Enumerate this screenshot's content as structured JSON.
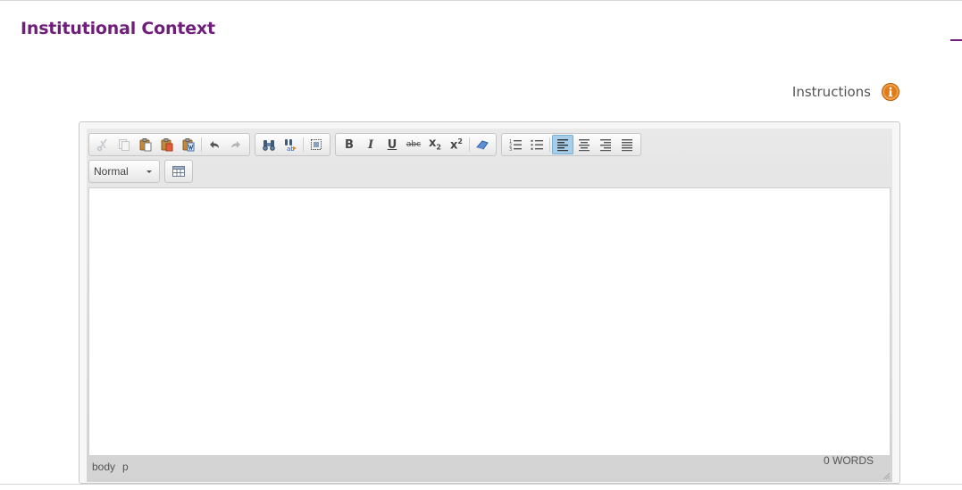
{
  "section": {
    "title": "Institutional Context"
  },
  "instructions": {
    "label": "Instructions",
    "icon": "info-icon",
    "icon_color": "#e07b16"
  },
  "colors": {
    "title": "#6f1f7a",
    "active_button": "#a6cde9"
  },
  "editor": {
    "toolbar_row1": [
      {
        "group": "clipboard",
        "buttons": [
          {
            "name": "cut",
            "icon": "scissors-icon",
            "enabled": false
          },
          {
            "name": "copy",
            "icon": "copy-icon",
            "enabled": false
          },
          {
            "name": "paste",
            "icon": "paste-icon",
            "enabled": true
          },
          {
            "name": "paste-as-text",
            "icon": "paste-text-icon",
            "enabled": true
          },
          {
            "name": "paste-from-word",
            "icon": "paste-word-icon",
            "enabled": true
          },
          {
            "name": "undo",
            "icon": "undo-icon",
            "enabled": true
          },
          {
            "name": "redo",
            "icon": "redo-icon",
            "enabled": false
          }
        ]
      },
      {
        "group": "editing",
        "buttons": [
          {
            "name": "find",
            "icon": "binoculars-icon",
            "enabled": true
          },
          {
            "name": "replace",
            "icon": "replace-icon",
            "enabled": true
          },
          {
            "name": "select-all",
            "icon": "select-all-icon",
            "enabled": true
          }
        ]
      },
      {
        "group": "basicstyles",
        "buttons": [
          {
            "name": "bold",
            "label": "B"
          },
          {
            "name": "italic",
            "label": "I"
          },
          {
            "name": "underline",
            "label": "U"
          },
          {
            "name": "strikethrough",
            "label": "abc"
          },
          {
            "name": "subscript",
            "label": "x",
            "script": "2"
          },
          {
            "name": "superscript",
            "label": "x",
            "script": "2"
          },
          {
            "name": "remove-format",
            "icon": "eraser-icon"
          }
        ]
      },
      {
        "group": "paragraph",
        "buttons": [
          {
            "name": "numbered-list",
            "icon": "numbered-list-icon"
          },
          {
            "name": "bulleted-list",
            "icon": "bulleted-list-icon"
          },
          {
            "name": "align-left",
            "icon": "align-left-icon",
            "active": true
          },
          {
            "name": "align-center",
            "icon": "align-center-icon"
          },
          {
            "name": "align-right",
            "icon": "align-right-icon"
          },
          {
            "name": "justify",
            "icon": "justify-icon"
          }
        ]
      }
    ],
    "format_value": "Normal",
    "table_icon": "table-icon",
    "content": "",
    "status_path": [
      "body",
      "p"
    ],
    "word_count": "0 WORDS"
  }
}
